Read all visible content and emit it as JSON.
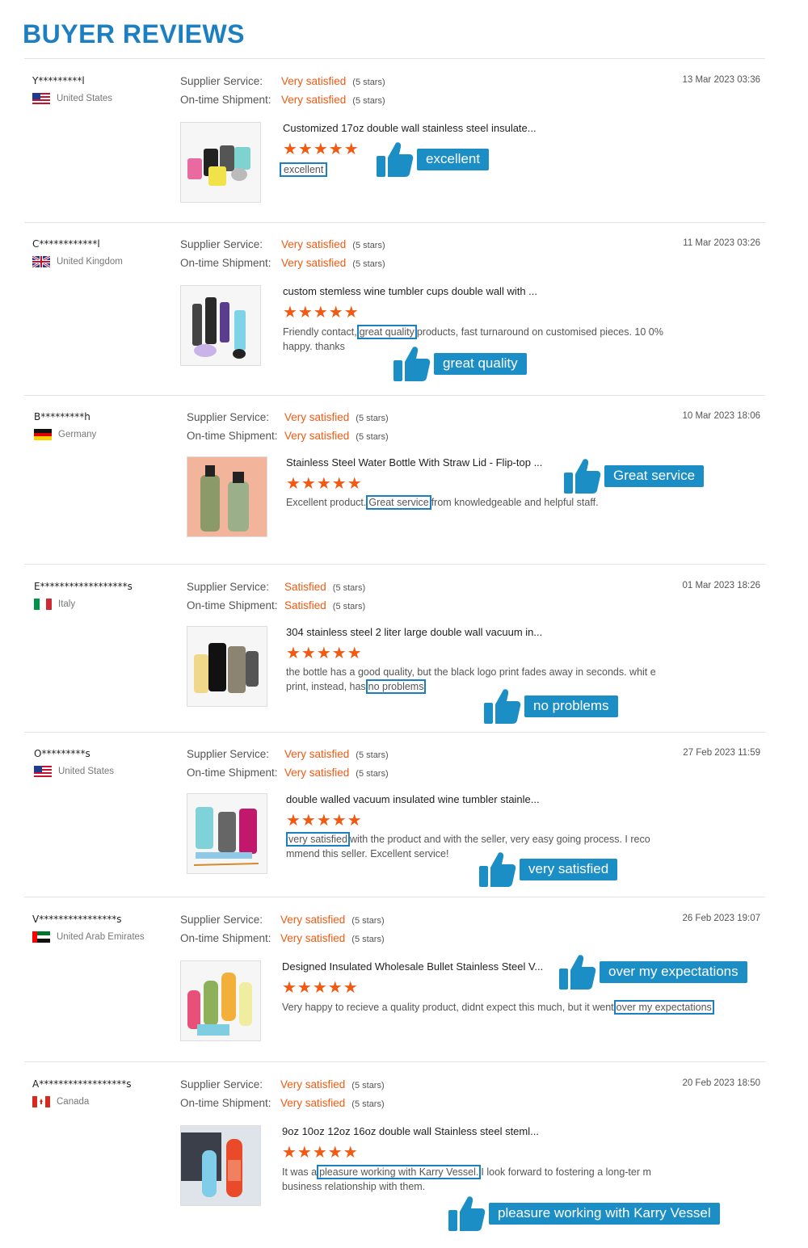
{
  "page_title": "BUYER REVIEWS",
  "labels": {
    "supplier": "Supplier Service:",
    "shipment": "On-time Shipment:",
    "stars_note": "(5 stars)"
  },
  "colors": {
    "accent": "#1c7fc1",
    "rating": "#f05a12"
  },
  "reviews": [
    {
      "buyer": "Y*********l",
      "country": "United States",
      "flag": "us",
      "date": "13 Mar 2023 03:36",
      "supplier": "Very satisfied",
      "shipment": "Very satisfied",
      "product": "Customized 17oz double wall stainless steel insulate...",
      "text_before": "",
      "highlight": "excellent",
      "text_after": "",
      "tag": "excellent",
      "stars": 5
    },
    {
      "buyer": "C************l",
      "country": "United Kingdom",
      "flag": "uk",
      "date": "11 Mar 2023 03:26",
      "supplier": "Very satisfied",
      "shipment": "Very satisfied",
      "product": "custom stemless wine tumbler cups double wall with ...",
      "text_before": "Friendly contact,",
      "highlight": "great quality",
      "text_after": "products, fast turnaround on customised pieces. 10 0% happy. thanks",
      "tag": "great quality",
      "stars": 5
    },
    {
      "buyer": "B*********h",
      "country": "Germany",
      "flag": "de",
      "date": "10 Mar 2023 18:06",
      "supplier": "Very satisfied",
      "shipment": "Very satisfied",
      "product": "Stainless Steel Water Bottle With Straw Lid - Flip-top ...",
      "text_before": "Excellent product.",
      "highlight": "Great service",
      "text_after": "from knowledgeable and helpful staff.",
      "tag": "Great service",
      "stars": 5
    },
    {
      "buyer": "E******************s",
      "country": "Italy",
      "flag": "it",
      "date": "01 Mar 2023 18:26",
      "supplier": "Satisfied",
      "shipment": "Satisfied",
      "product": "304 stainless steel 2 liter large double wall vacuum in...",
      "text_before": "the bottle has a good quality, but the black logo print fades away in seconds. whit e print, instead, has",
      "highlight": "no problems",
      "text_after": "",
      "tag": "no problems",
      "stars": 5
    },
    {
      "buyer": "O*********s",
      "country": "United States",
      "flag": "us",
      "date": "27 Feb 2023 11:59",
      "supplier": "Very satisfied",
      "shipment": "Very satisfied",
      "product": "double walled vacuum insulated wine tumbler stainle...",
      "text_before": "",
      "highlight": "very satisfied",
      "text_after": "with the product and with the seller, very easy going process. I reco mmend this seller. Excellent service!",
      "tag": "very satisfied",
      "stars": 5
    },
    {
      "buyer": "V****************s",
      "country": "United Arab Emirates",
      "flag": "ae",
      "date": "26 Feb 2023 19:07",
      "supplier": "Very satisfied",
      "shipment": "Very satisfied",
      "product": "Designed Insulated Wholesale Bullet Stainless Steel V...",
      "text_before": "Very happy to recieve a quality product, didnt expect this much, but it went",
      "highlight": "over my expectations",
      "text_after": "",
      "tag": "over my expectations",
      "stars": 5
    },
    {
      "buyer": "A******************s",
      "country": "Canada",
      "flag": "ca",
      "date": "20 Feb 2023 18:50",
      "supplier": "Very satisfied",
      "shipment": "Very satisfied",
      "product": "9oz 10oz 12oz 16oz double wall Stainless steel steml...",
      "text_before": "It was a",
      "highlight": "pleasure working with Karry Vessel.",
      "text_after": "I look forward to fostering a long-ter m business relationship with them.",
      "tag": "pleasure working with Karry Vessel",
      "stars": 5
    }
  ]
}
